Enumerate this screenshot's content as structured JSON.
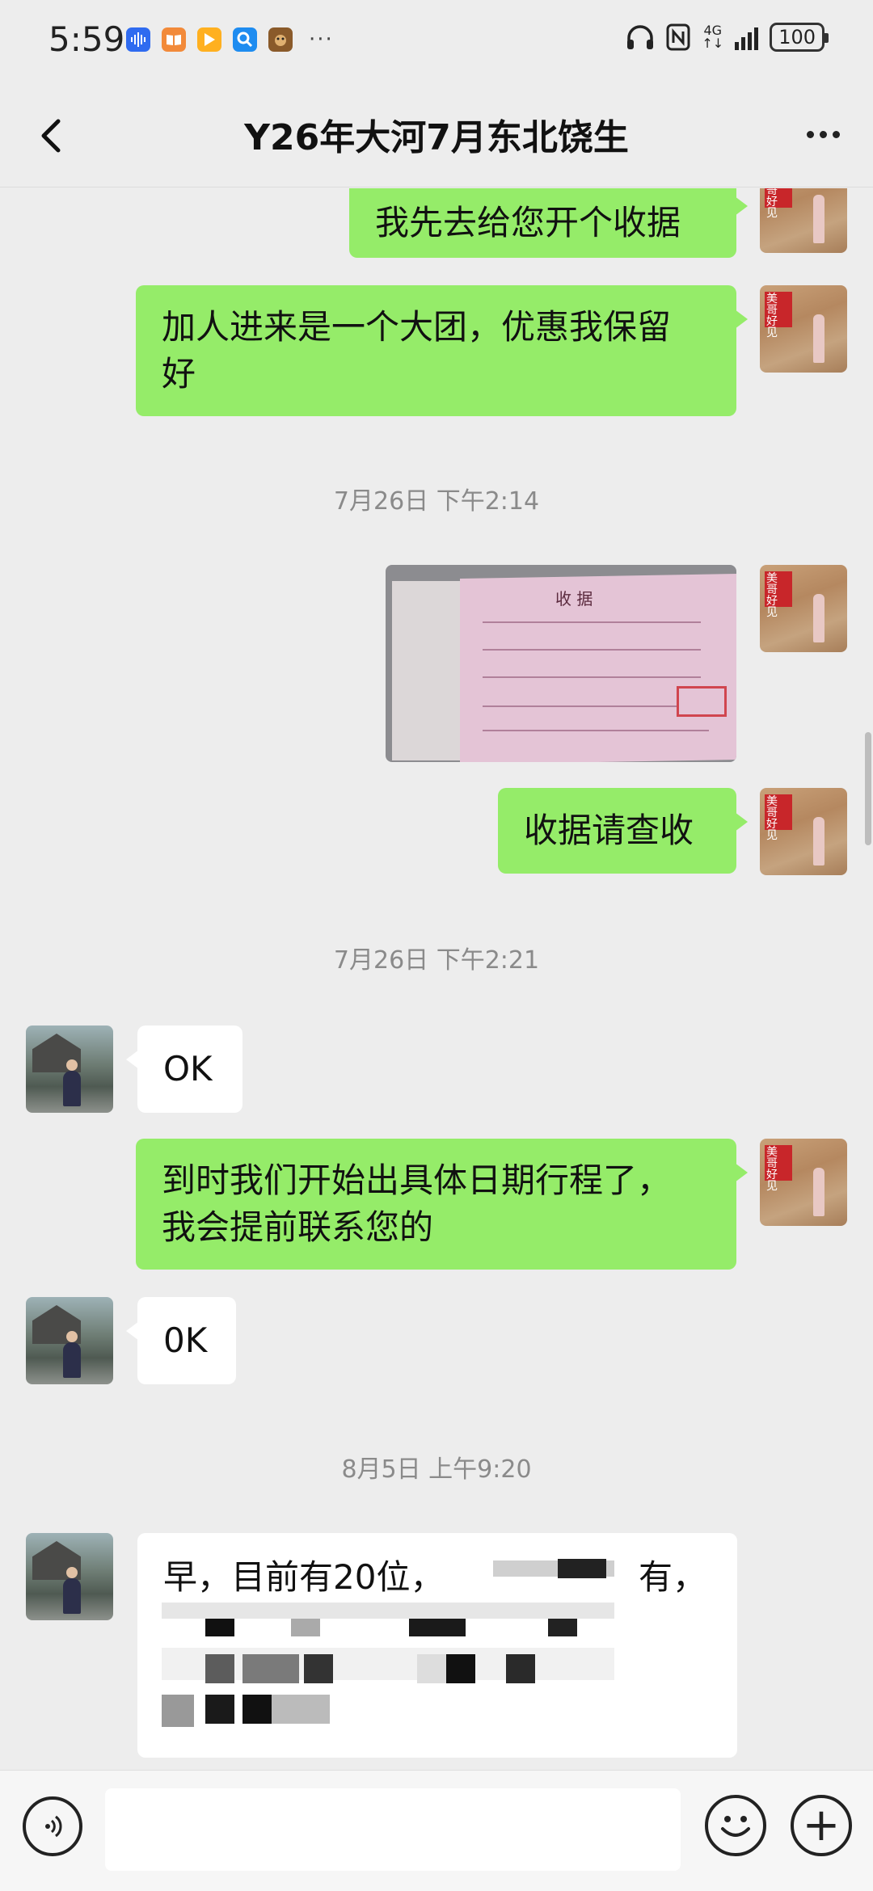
{
  "status_bar": {
    "time": "5:59",
    "network": "4G",
    "battery": "100",
    "more_indicator": "···",
    "app_icons": [
      "voice-app-icon",
      "book-app-icon",
      "video-app-icon",
      "search-app-icon",
      "game-app-icon"
    ]
  },
  "header": {
    "title": "Y26年大河7月东北饶生",
    "back_icon": "chevron-left-icon",
    "more_icon": "more-dots-icon"
  },
  "messages": [
    {
      "sender": "me",
      "type": "text",
      "text": "我先去给您开个收据"
    },
    {
      "sender": "me",
      "type": "text",
      "lines": [
        "加人进来是一个大团，优惠我保留",
        "好"
      ]
    },
    {
      "type": "timestamp",
      "text": "7月26日 下午2:14"
    },
    {
      "sender": "me",
      "type": "image",
      "image_title": "收  据",
      "image_label": "receipt-photo"
    },
    {
      "sender": "me",
      "type": "text",
      "text": "收据请查收"
    },
    {
      "type": "timestamp",
      "text": "7月26日 下午2:21"
    },
    {
      "sender": "other",
      "type": "text",
      "text": "OK"
    },
    {
      "sender": "me",
      "type": "text",
      "lines": [
        "到时我们开始出具体日期行程了，",
        "我会提前联系您的"
      ]
    },
    {
      "sender": "other",
      "type": "text",
      "text": "0K"
    },
    {
      "type": "timestamp",
      "text": "8月5日 上午9:20"
    },
    {
      "sender": "other",
      "type": "text",
      "partial_text": "早，目前有20位，",
      "partial_text_2": "有，",
      "redacted": true
    }
  ],
  "input": {
    "placeholder": "",
    "value": ""
  },
  "bottom_bar": {
    "voice_icon": "voice-icon",
    "emoji_icon": "emoji-icon",
    "plus_icon": "plus-icon",
    "plus_glyph": "+"
  },
  "colors": {
    "my_bubble": "#95ec69",
    "other_bubble": "#ffffff",
    "background": "#ededed"
  }
}
